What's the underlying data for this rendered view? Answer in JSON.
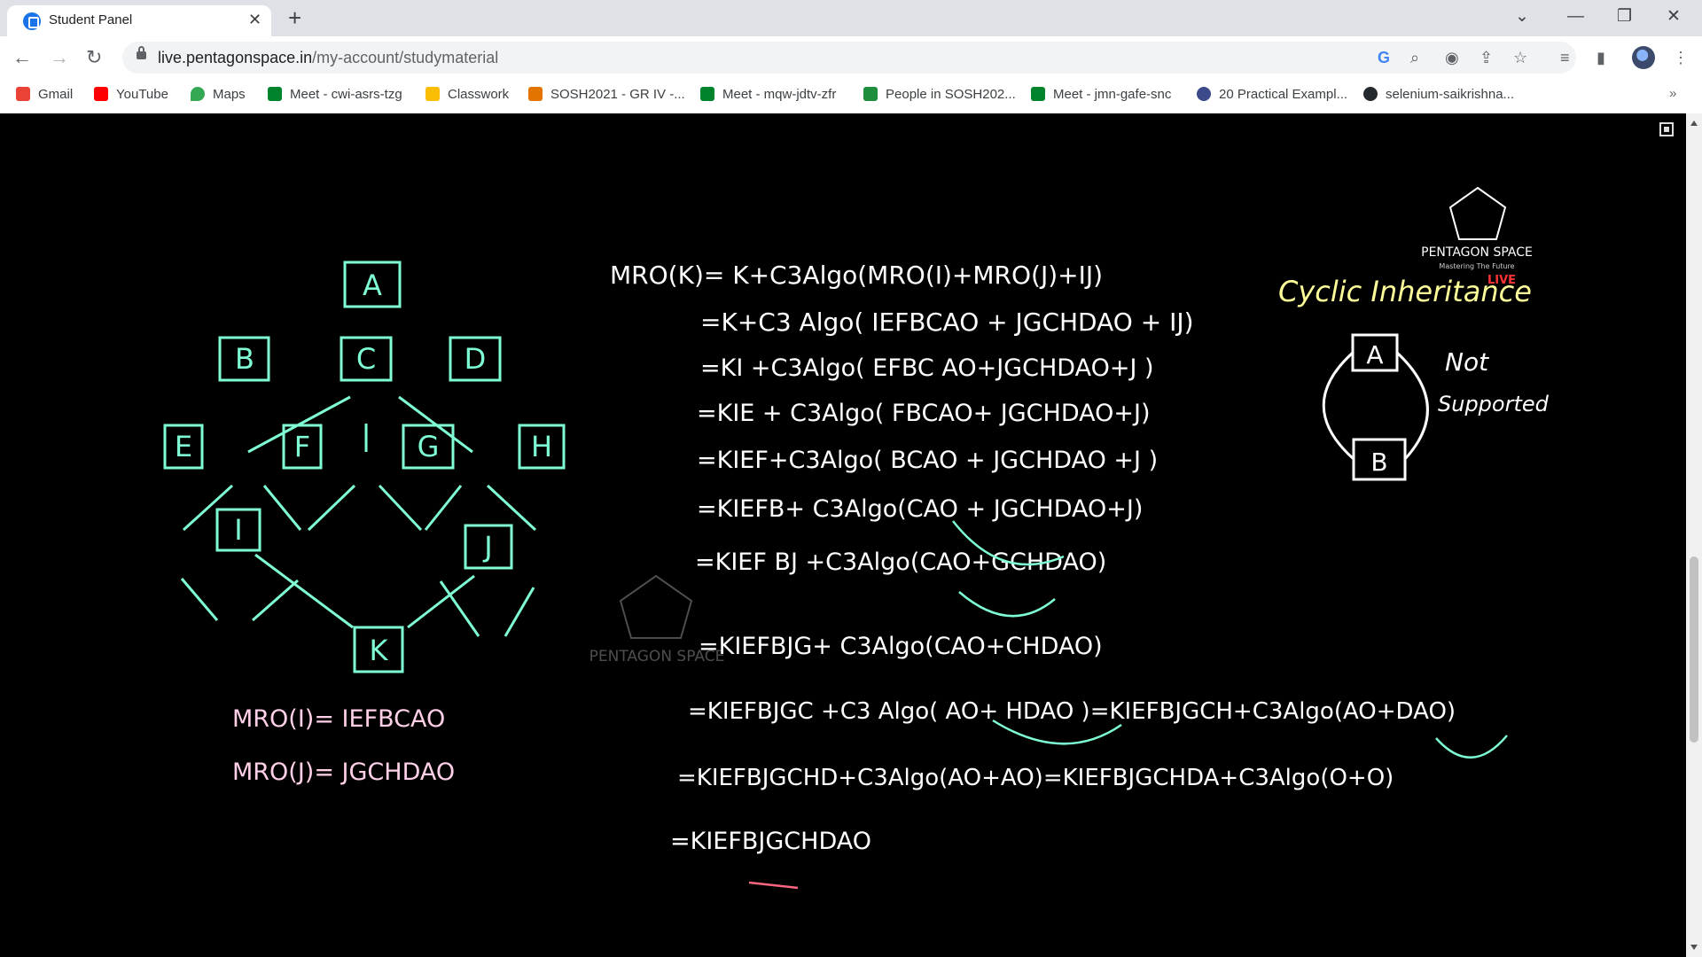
{
  "browser": {
    "tab_title": "Student Panel",
    "tab_close": "✕",
    "new_tab": "+",
    "url_host": "live.pentagonspace.in",
    "url_path": "/my-account/studymaterial",
    "colors": {
      "tabstrip": "#dee1e6",
      "accent": "#1a73e8"
    }
  },
  "bookmarks": [
    {
      "label": "Gmail",
      "icon": "gmail-icon",
      "color": "#ea4335"
    },
    {
      "label": "YouTube",
      "icon": "youtube-icon",
      "color": "#ff0000"
    },
    {
      "label": "Maps",
      "icon": "maps-icon",
      "color": "#34a853"
    },
    {
      "label": "Meet - cwi-asrs-tzg",
      "icon": "meet-icon",
      "color": "#00832d"
    },
    {
      "label": "Classwork",
      "icon": "classroom-icon",
      "color": "#fbbc04"
    },
    {
      "label": "SOSH2021 - GR IV -...",
      "icon": "slides-icon",
      "color": "#e37400"
    },
    {
      "label": "Meet - mqw-jdtv-zfr",
      "icon": "meet-icon",
      "color": "#00832d"
    },
    {
      "label": "People in SOSH202...",
      "icon": "classroom-icon",
      "color": "#1e8e3e"
    },
    {
      "label": "Meet - jmn-gafe-snc",
      "icon": "meet-icon",
      "color": "#00832d"
    },
    {
      "label": "20 Practical Exampl...",
      "icon": "site-icon",
      "color": "#3c4a8c"
    },
    {
      "label": "selenium-saikrishna...",
      "icon": "github-icon",
      "color": "#24292e"
    }
  ],
  "board": {
    "brand": "PENTAGON SPACE",
    "tagline": "Mastering The Future",
    "live": "LIVE",
    "diagram_nodes": [
      "A",
      "B",
      "C",
      "D",
      "E",
      "F",
      "G",
      "H",
      "I",
      "J",
      "K"
    ],
    "mro_i": "MRO(I)= IEFBCAO",
    "mro_j": "MRO(J)= JGCHDAO",
    "steps": [
      "MRO(K)= K+C3Algo(MRO(I)+MRO(J)+IJ)",
      "=K+C3 Algo( IEFBCAO + JGCHDAO + IJ)",
      "=KI +C3Algo( EFBC AO+JGCHDAO+J )",
      "=KIE + C3Algo( FBCAO+ JGCHDAO+J)",
      "=KIEF+C3Algo( BCAO + JGCHDAO +J )",
      "=KIEFB+ C3Algo(CAO + JGCHDAO+J)",
      "=KIEF BJ +C3Algo(CAO+GCHDAO)",
      "=KIEFBJG+ C3Algo(CAO+CHDAO)",
      "=KIEFBJGC +C3 Algo( AO+ HDAO )=KIEFBJGCH+C3Algo(AO+DAO)",
      "=KIEFBJGCHD+C3Algo(AO+AO)=KIEFBJGCHDA+C3Algo(O+O)",
      "=KIEFBJGCHDAO"
    ],
    "cyclic_title": "Cyclic Inheritance",
    "cyclic_a": "A",
    "cyclic_b": "B",
    "not_supported_1": "Not",
    "not_supported_2": "Supported",
    "colors": {
      "ink_cyan": "#7fffd4",
      "ink_white": "#ffffff",
      "ink_yellow": "#ffff99",
      "ink_red": "#ff3333"
    }
  }
}
